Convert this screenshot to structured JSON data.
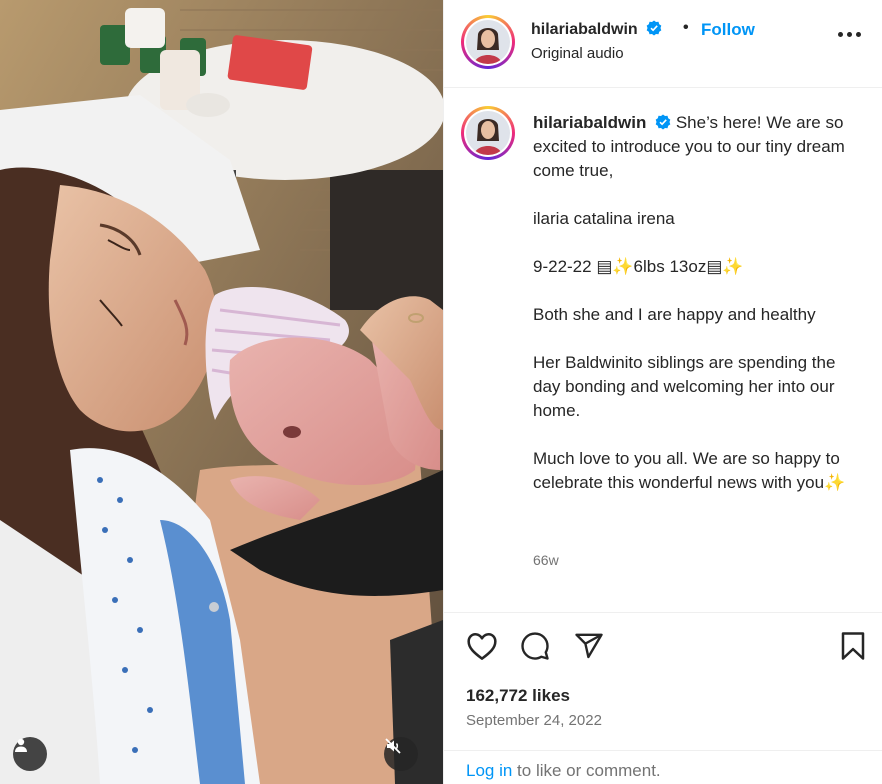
{
  "media": {
    "description_icon": "photo-of-mother-holding-newborn",
    "user_tag_icon": "user-tag-icon",
    "mute_icon": "speaker-muted-icon"
  },
  "header": {
    "username": "hilariabaldwin",
    "separator": "•",
    "follow_label": "Follow",
    "subtitle": "Original audio"
  },
  "caption": {
    "username": "hilariabaldwin",
    "paragraphs": [
      "She’s here! We are so excited to introduce you to our tiny dream come true,",
      "ilaria catalina irena",
      "9-22-22 ▤✨6lbs 13oz▤✨",
      "Both she and I are happy and healthy",
      "Her Baldwinito siblings are spending the day bonding and welcoming her into our home.",
      "Much love to you all. We are so happy to celebrate this wonderful news with you✨"
    ],
    "timestamp": "66w"
  },
  "footer": {
    "likes": "162,772 likes",
    "date": "September 24, 2022",
    "login_link": "Log in",
    "login_suffix": " to like or comment."
  },
  "colors": {
    "accent": "#0095f6",
    "text": "#262626",
    "muted": "#737373",
    "border": "#efefef"
  }
}
